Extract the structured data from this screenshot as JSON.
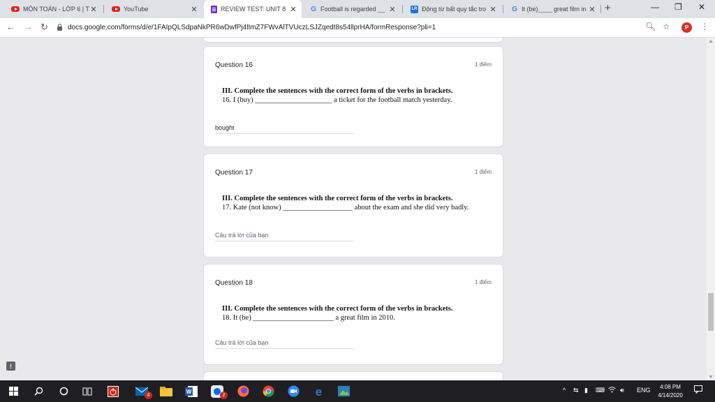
{
  "browser": {
    "tabs": [
      {
        "title": "MÔN TOÁN - LỚP 6 | Ti",
        "icon": "youtube-icon",
        "active": false
      },
      {
        "title": "YouTube",
        "icon": "youtube-icon",
        "active": false
      },
      {
        "title": "REVIEW TEST: UNIT 8",
        "icon": "google-forms-icon",
        "active": true
      },
      {
        "title": "Football is regarded __",
        "icon": "google-icon",
        "active": false
      },
      {
        "title": "Động từ bất quy tắc tro",
        "icon": "lr-icon",
        "active": false
      },
      {
        "title": "It (be)____ great film in",
        "icon": "google-icon",
        "active": false
      }
    ],
    "url": "docs.google.com/forms/d/e/1FAIpQLSdpaNkPR6wDwfPj4lImZ7FWvAlTVUczLSJZqedt8s54llprHA/formResponse?pli=1",
    "profile_initial": "P"
  },
  "questions": [
    {
      "title": "Question 16",
      "points": "1 điểm",
      "instruction": "III. Complete the sentences with the correct form of the verbs in brackets.",
      "sentence": "16. I (buy) _____________________ a ticket for the football match yesterday.",
      "answer": "bought",
      "answer_is_placeholder": false
    },
    {
      "title": "Question 17",
      "points": "1 điểm",
      "instruction": "III. Complete the sentences with the correct form of the verbs in brackets.",
      "sentence": "17. Kate (not know) ___________________ about the exam and she did very badly.",
      "answer": "Câu trả lời của bạn",
      "answer_is_placeholder": true
    },
    {
      "title": "Question 18",
      "points": "1 điểm",
      "instruction": "III. Complete the sentences with the correct form of the verbs in brackets.",
      "sentence": "18. It (be) ______________________ a great film in 2010.",
      "answer": "Câu trả lời của bạn",
      "answer_is_placeholder": true
    }
  ],
  "taskbar": {
    "badges": {
      "mail": "4",
      "zalo": "2"
    },
    "language": "ENG",
    "time": "4:08 PM",
    "date": "4/14/2020"
  }
}
